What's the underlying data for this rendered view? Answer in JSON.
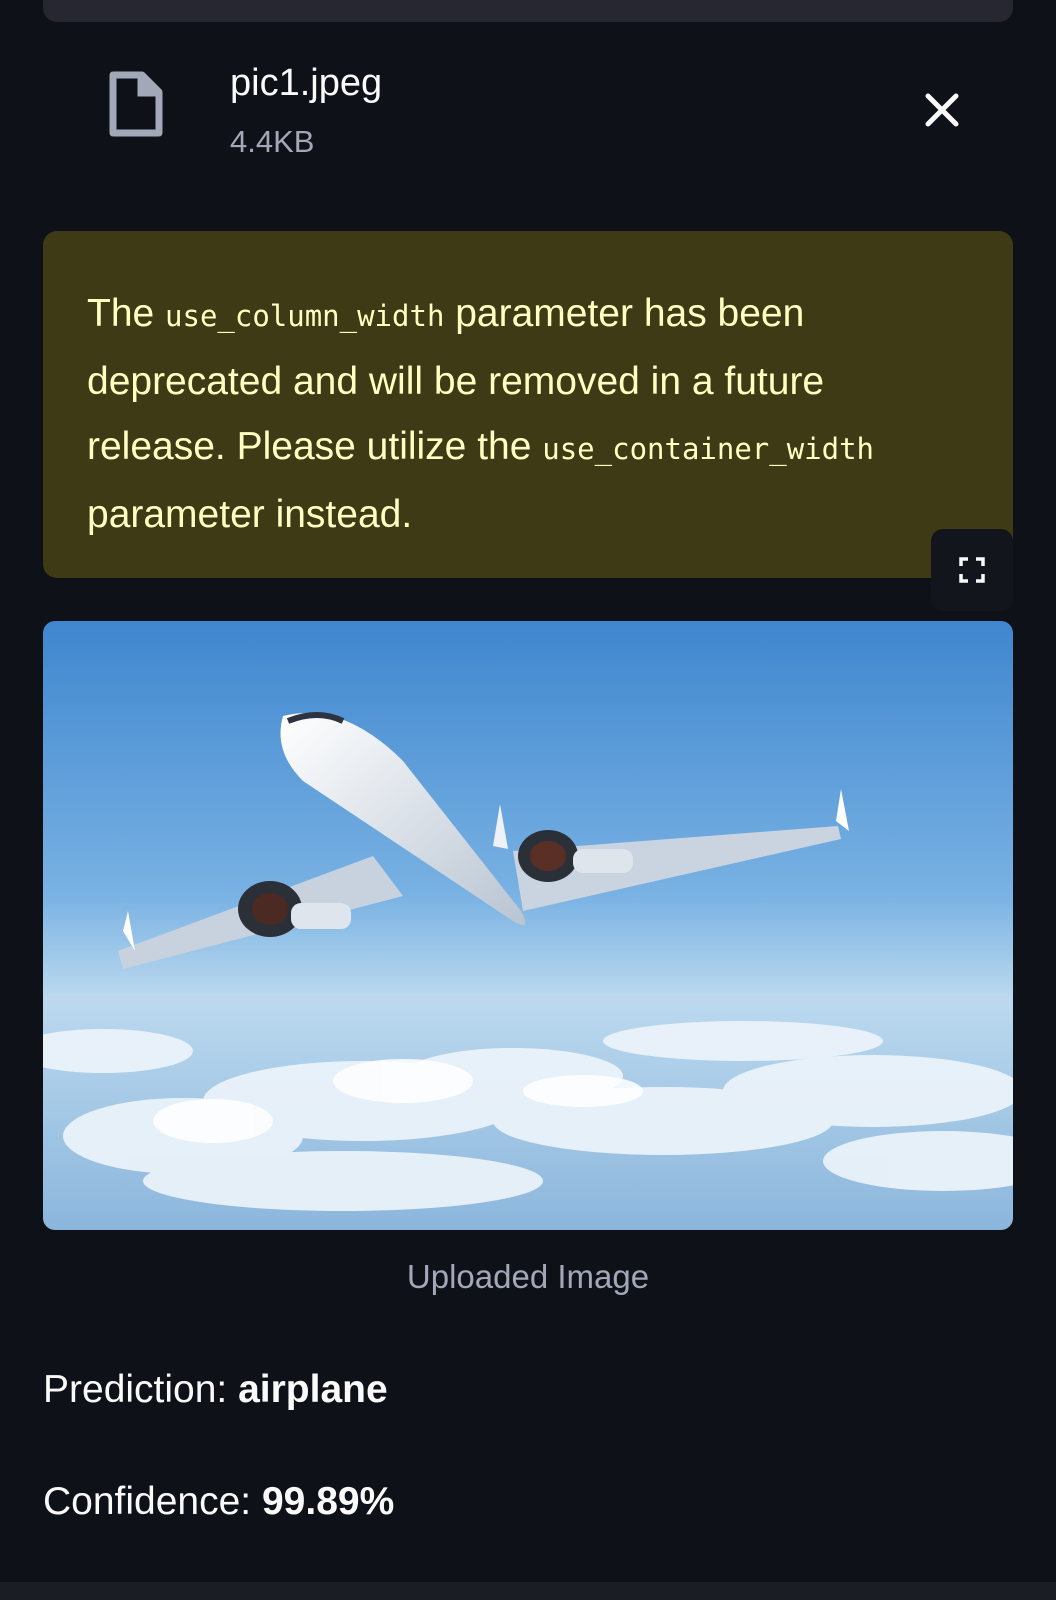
{
  "file": {
    "name": "pic1.jpeg",
    "size": "4.4KB",
    "icon": "file-icon",
    "close_icon": "close-icon"
  },
  "warning": {
    "text_1": "The ",
    "code_1": "use_column_width",
    "text_2": " parameter has been deprecated and will be removed in a future release. Please utilize the ",
    "code_2": "use_container_width",
    "text_3": " parameter instead.",
    "bg_color": "#3e3a16",
    "text_color": "#ffffc2"
  },
  "image": {
    "alt": "airplane flying above clouds",
    "fullscreen_icon": "fullscreen-icon",
    "caption": "Uploaded Image"
  },
  "result": {
    "prediction_label": "Prediction: ",
    "prediction_value": "airplane",
    "confidence_label": "Confidence: ",
    "confidence_value": "99.89%"
  },
  "colors": {
    "background": "#0e1117",
    "text": "#fafafa",
    "muted": "#a3a8b8"
  }
}
